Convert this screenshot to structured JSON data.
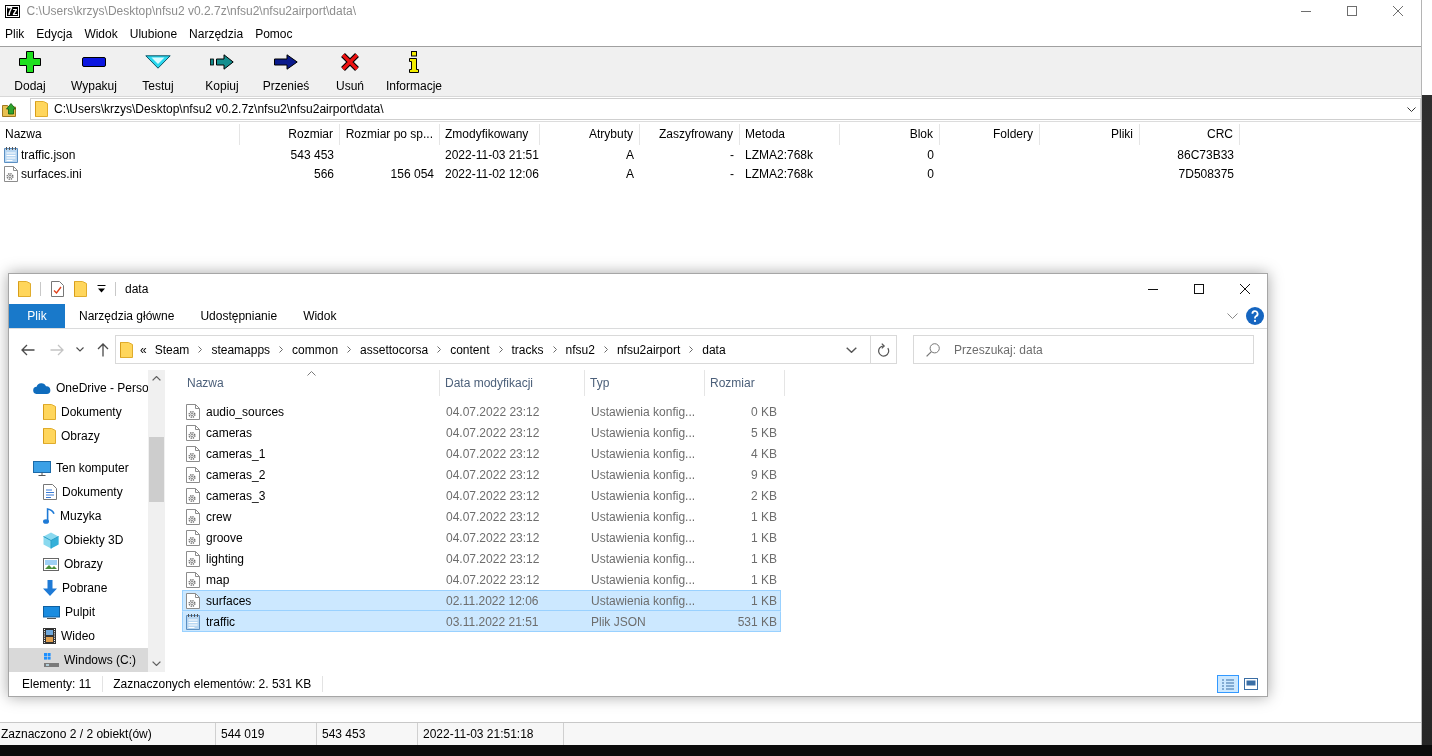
{
  "sevenzip": {
    "window": {
      "logo": "7z",
      "title": "C:\\Users\\krzys\\Desktop\\nfsu2 v0.2.7z\\nfsu2\\nfsu2airport\\data\\"
    },
    "menu": [
      "Plik",
      "Edycja",
      "Widok",
      "Ulubione",
      "Narzędzia",
      "Pomoc"
    ],
    "toolbar": [
      {
        "kind": "add",
        "label": "Dodaj"
      },
      {
        "kind": "extract",
        "label": "Wypakuj"
      },
      {
        "kind": "test",
        "label": "Testuj"
      },
      {
        "kind": "copy",
        "label": "Kopiuj"
      },
      {
        "kind": "move",
        "label": "Przenieś"
      },
      {
        "kind": "delete",
        "label": "Usuń"
      },
      {
        "kind": "info",
        "label": "Informacje"
      }
    ],
    "address": {
      "value": "C:\\Users\\krzys\\Desktop\\nfsu2 v0.2.7z\\nfsu2\\nfsu2airport\\data\\"
    },
    "table": {
      "columns": [
        {
          "label": "Nazwa",
          "kind": "name"
        },
        {
          "label": "Rozmiar",
          "kind": "number"
        },
        {
          "label": "Rozmiar po sp...",
          "kind": "number"
        },
        {
          "label": "Zmodyfikowany",
          "kind": "date"
        },
        {
          "label": "Atrybuty",
          "kind": "number"
        },
        {
          "label": "Zaszyfrowany",
          "kind": "number"
        },
        {
          "label": "Metoda",
          "kind": "text"
        },
        {
          "label": "Blok",
          "kind": "number"
        },
        {
          "label": "Foldery",
          "kind": "number"
        },
        {
          "label": "Pliki",
          "kind": "number"
        },
        {
          "label": "CRC",
          "kind": "number"
        }
      ],
      "rows": [
        {
          "kind": "json",
          "cells": [
            "traffic.json",
            "543 453",
            null,
            "2022-11-03 21:51",
            "A",
            "-",
            "LZMA2:768k",
            "0",
            null,
            null,
            "86C73B33"
          ]
        },
        {
          "kind": "config",
          "cells": [
            "surfaces.ini",
            "566",
            "156 054",
            "2022-11-02 12:06",
            "A",
            "-",
            "LZMA2:768k",
            "0",
            null,
            null,
            "7D508375"
          ]
        }
      ]
    },
    "status_bar": [
      "Zaznaczono 2 / 2 obiekt(ów)",
      "544 019",
      "543 453",
      "2022-11-03 21:51:18"
    ]
  },
  "explorer": {
    "window": {
      "title": "data"
    },
    "ribbon": [
      {
        "kind": "menu",
        "label": "Plik"
      },
      {
        "kind": "tab",
        "label": "Narzędzia główne"
      },
      {
        "kind": "tab",
        "label": "Udostępnianie"
      },
      {
        "kind": "tab",
        "label": "Widok"
      }
    ],
    "nav_buttons": [
      {
        "kind": "back",
        "disabled": false
      },
      {
        "kind": "forward",
        "disabled": true
      },
      {
        "kind": "recent",
        "disabled": false
      },
      {
        "kind": "up",
        "disabled": false
      }
    ],
    "address": {
      "overflow": "«",
      "breadcrumbs": [
        "Steam",
        "steamapps",
        "common",
        "assettocorsa",
        "content",
        "tracks",
        "nfsu2",
        "nfsu2airport",
        "data"
      ]
    },
    "search": {
      "placeholder": "Przeszukaj: data"
    },
    "nav_pane": {
      "items": [
        {
          "kind": "cloud",
          "label": "OneDrive - Perso",
          "selected": false,
          "children": [
            {
              "kind": "folder",
              "label": "Dokumenty",
              "selected": false
            },
            {
              "kind": "folder",
              "label": "Obrazy",
              "selected": false
            }
          ]
        },
        {
          "kind": "pc",
          "label": "Ten komputer",
          "selected": false,
          "children": [
            {
              "kind": "documents",
              "label": "Dokumenty",
              "selected": false
            },
            {
              "kind": "music",
              "label": "Muzyka",
              "selected": false
            },
            {
              "kind": "objects",
              "label": "Obiekty 3D",
              "selected": false
            },
            {
              "kind": "pictures",
              "label": "Obrazy",
              "selected": false
            },
            {
              "kind": "downloads",
              "label": "Pobrane",
              "selected": false
            },
            {
              "kind": "desktop",
              "label": "Pulpit",
              "selected": false
            },
            {
              "kind": "videos",
              "label": "Wideo",
              "selected": false
            },
            {
              "kind": "drive",
              "label": "Windows (C:)",
              "selected": true
            }
          ]
        }
      ]
    },
    "columns": [
      {
        "label": "Nazwa",
        "sorted": true
      },
      {
        "label": "Data modyfikacji",
        "sorted": false
      },
      {
        "label": "Typ",
        "sorted": false
      },
      {
        "label": "Rozmiar",
        "sorted": false
      }
    ],
    "files": [
      {
        "kind": "config",
        "name": "audio_sources",
        "modified": "04.07.2022 23:12",
        "type": "Ustawienia konfig...",
        "size": "0 KB",
        "selected": false
      },
      {
        "kind": "config",
        "name": "cameras",
        "modified": "04.07.2022 23:12",
        "type": "Ustawienia konfig...",
        "size": "5 KB",
        "selected": false
      },
      {
        "kind": "config",
        "name": "cameras_1",
        "modified": "04.07.2022 23:12",
        "type": "Ustawienia konfig...",
        "size": "4 KB",
        "selected": false
      },
      {
        "kind": "config",
        "name": "cameras_2",
        "modified": "04.07.2022 23:12",
        "type": "Ustawienia konfig...",
        "size": "9 KB",
        "selected": false
      },
      {
        "kind": "config",
        "name": "cameras_3",
        "modified": "04.07.2022 23:12",
        "type": "Ustawienia konfig...",
        "size": "2 KB",
        "selected": false
      },
      {
        "kind": "config",
        "name": "crew",
        "modified": "04.07.2022 23:12",
        "type": "Ustawienia konfig...",
        "size": "1 KB",
        "selected": false
      },
      {
        "kind": "config",
        "name": "groove",
        "modified": "04.07.2022 23:12",
        "type": "Ustawienia konfig...",
        "size": "1 KB",
        "selected": false
      },
      {
        "kind": "config",
        "name": "lighting",
        "modified": "04.07.2022 23:12",
        "type": "Ustawienia konfig...",
        "size": "1 KB",
        "selected": false
      },
      {
        "kind": "config",
        "name": "map",
        "modified": "04.07.2022 23:12",
        "type": "Ustawienia konfig...",
        "size": "1 KB",
        "selected": false
      },
      {
        "kind": "config",
        "name": "surfaces",
        "modified": "02.11.2022 12:06",
        "type": "Ustawienia konfig...",
        "size": "1 KB",
        "selected": true
      },
      {
        "kind": "json",
        "name": "traffic",
        "modified": "03.11.2022 21:51",
        "type": "Plik JSON",
        "size": "531 KB",
        "selected": true
      }
    ],
    "status_bar": {
      "count": "Elementy: 11",
      "selection": "Zaznaczonych elementów: 2. 531 KB"
    },
    "view_buttons": [
      {
        "kind": "details",
        "selected": true
      },
      {
        "kind": "tiles",
        "selected": false
      }
    ]
  }
}
